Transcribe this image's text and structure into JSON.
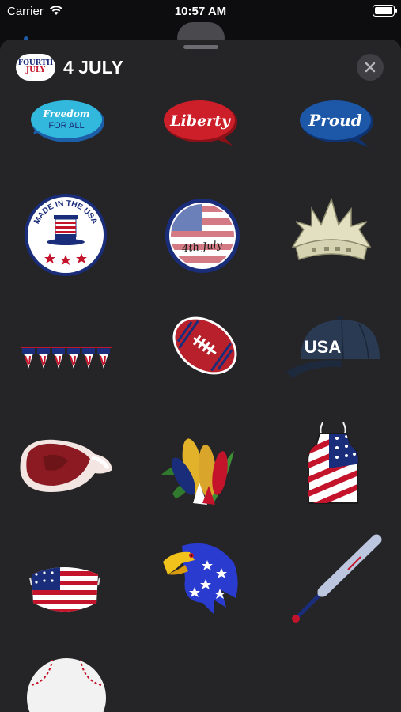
{
  "status_bar": {
    "carrier": "Carrier",
    "time": "10:57 AM"
  },
  "header": {
    "title": "4 JULY",
    "app_icon": {
      "line1": "FOURTH",
      "line2": "JULY"
    },
    "close_icon": "close-icon"
  },
  "stickers": [
    {
      "name": "freedom-for-all",
      "line1": "Freedom",
      "line2": "FOR ALL"
    },
    {
      "name": "liberty",
      "text": "Liberty"
    },
    {
      "name": "proud",
      "text": "Proud"
    },
    {
      "name": "made-in-usa-badge",
      "text": "MADE IN THE USA"
    },
    {
      "name": "4th-july-badge",
      "text": "4th July"
    },
    {
      "name": "statue-of-liberty-crown"
    },
    {
      "name": "flag-bunting"
    },
    {
      "name": "american-football"
    },
    {
      "name": "usa-cap",
      "text": "USA"
    },
    {
      "name": "steak"
    },
    {
      "name": "corn-cobs"
    },
    {
      "name": "flag-apron"
    },
    {
      "name": "flag-face-mask"
    },
    {
      "name": "patriotic-eagle"
    },
    {
      "name": "baseball-bat"
    },
    {
      "name": "baseball"
    }
  ],
  "colors": {
    "sheet_bg": "#252527",
    "flag_red": "#c4142b",
    "flag_blue": "#1a2d7a",
    "bubble_cyan": "#33b8dd",
    "bubble_red": "#cc1f2a",
    "bubble_blue": "#1c57a8"
  }
}
